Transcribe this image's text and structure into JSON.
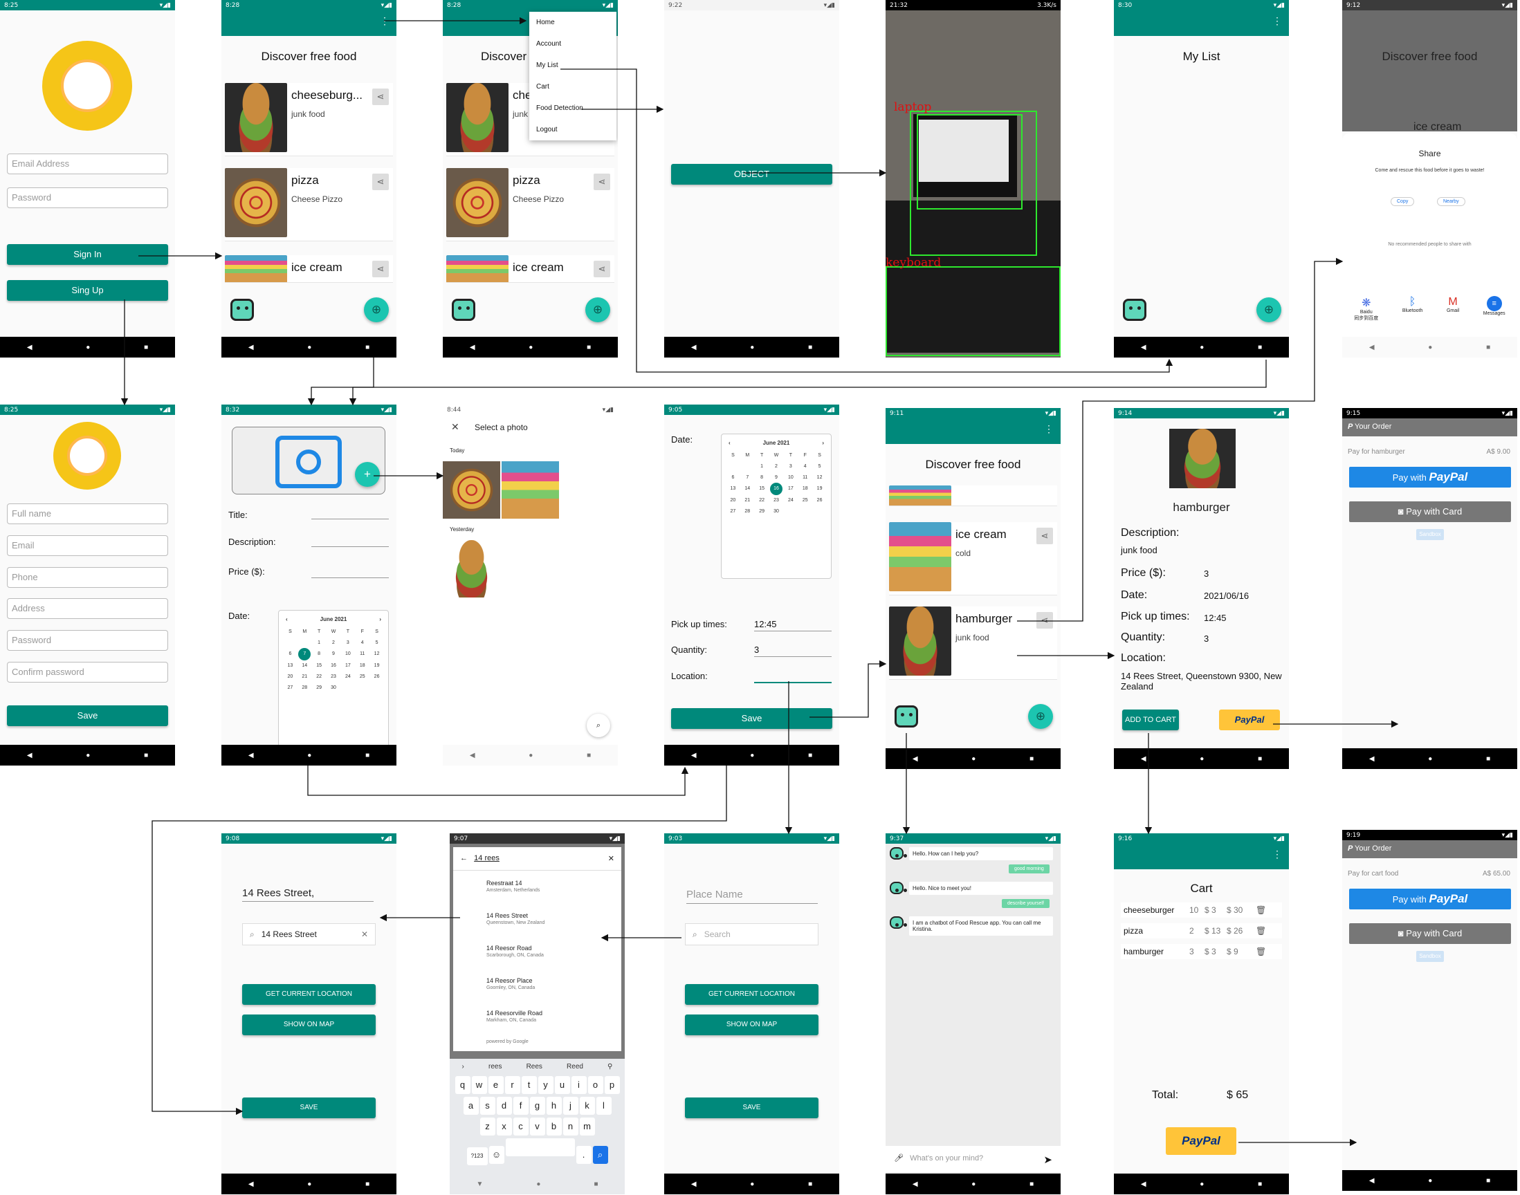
{
  "row1": {
    "login": {
      "time": "8:25",
      "email_placeholder": "Email Address",
      "password_placeholder": "Password",
      "signin": "Sign In",
      "signup": "Sing Up"
    },
    "discover": {
      "time": "8:28",
      "title": "Discover free food",
      "items": [
        {
          "name": "cheeseburg...",
          "desc": "junk food"
        },
        {
          "name": "pizza",
          "desc": "Cheese Pizzo"
        },
        {
          "name": "ice cream",
          "desc": ""
        }
      ]
    },
    "menu_screen": {
      "time": "8:28",
      "title": "Discover",
      "item1": "che",
      "item1_desc": "junk",
      "menu": [
        "Home",
        "Account",
        "My List",
        "Cart",
        "Food Detection",
        "Logout"
      ],
      "items": [
        {
          "name": "pizza",
          "desc": "Cheese Pizzo"
        },
        {
          "name": "ice cream"
        }
      ]
    },
    "object": {
      "time": "9:22",
      "button": "OBJECT"
    },
    "camera": {
      "time": "21:32",
      "speed": "3.3K/s",
      "labels": [
        "laptop",
        "keyboard"
      ]
    },
    "mylist": {
      "time": "8:30",
      "title": "My List"
    },
    "share": {
      "time": "9:12",
      "bg_title": "Discover free food",
      "bg_item": "ice cream",
      "title": "Share",
      "message": "Come and rescue this food before it goes to waste!",
      "copy": "Copy",
      "nearby": "Nearby",
      "no_rec": "No recommended people to share with",
      "apps": [
        {
          "name": "Baidu",
          "sub": "同步到百度"
        },
        {
          "name": "Bluetooth"
        },
        {
          "name": "Gmail"
        },
        {
          "name": "Messages"
        }
      ]
    }
  },
  "row2": {
    "register": {
      "time": "8:25",
      "fields": [
        "Full name",
        "Email",
        "Phone",
        "Address",
        "Password",
        "Confirm password"
      ],
      "save": "Save"
    },
    "addfood": {
      "time": "8:32",
      "title_lbl": "Title:",
      "desc_lbl": "Description:",
      "price_lbl": "Price ($):",
      "date_lbl": "Date:",
      "cal_month": "June 2021"
    },
    "photo": {
      "time": "8:44",
      "title": "Select a photo",
      "today": "Today",
      "yesterday": "Yesterday"
    },
    "datepick": {
      "time": "9:05",
      "date_lbl": "Date:",
      "cal_month": "June 2021",
      "pickup_lbl": "Pick up times:",
      "pickup": "12:45",
      "qty_lbl": "Quantity:",
      "qty": "3",
      "loc_lbl": "Location:",
      "save": "Save"
    },
    "discover2": {
      "time": "9:11",
      "title": "Discover free food",
      "items": [
        {
          "name": "ice cream",
          "desc": "cold"
        },
        {
          "name": "hamburger",
          "desc": "junk food"
        }
      ]
    },
    "detail": {
      "time": "9:14",
      "name": "hamburger",
      "desc_lbl": "Description:",
      "desc": "junk food",
      "price_lbl": "Price ($):",
      "price": "3",
      "date_lbl": "Date:",
      "date": "2021/06/16",
      "pickup_lbl": "Pick up times:",
      "pickup": "12:45",
      "qty_lbl": "Quantity:",
      "qty": "3",
      "loc_lbl": "Location:",
      "location": "14 Rees Street, Queenstown 9300, New Zealand",
      "add_cart": "ADD TO CART",
      "paypal": "PayPal"
    },
    "order1": {
      "time": "9:15",
      "header": "Your Order",
      "pay_for": "Pay for hamburger",
      "amount": "A$ 9.00",
      "pay_with": "Pay with",
      "paypal": "PayPal",
      "card": "Pay with Card",
      "sandbox": "Sandbox"
    }
  },
  "row3": {
    "address": {
      "time": "9:08",
      "street": "14 Rees Street,",
      "search": "14 Rees Street",
      "current": "GET CURRENT LOCATION",
      "show_map": "SHOW ON MAP",
      "save": "SAVE"
    },
    "autocomplete": {
      "time": "9:07",
      "query": "14 rees",
      "results": [
        {
          "name": "Reestraat 14",
          "addr": "Amsterdam, Netherlands"
        },
        {
          "name": "14 Rees Street",
          "addr": "Queenstown, New Zealand"
        },
        {
          "name": "14 Reesor Road",
          "addr": "Scarborough, ON, Canada"
        },
        {
          "name": "14 Reesor Place",
          "addr": "Goomley, ON, Canada"
        },
        {
          "name": "14 Reesorville Road",
          "addr": "Markham, ON, Canada"
        }
      ],
      "powered": "powered by Google",
      "suggest": [
        "rees",
        "Rees",
        "Reed"
      ],
      "row1": [
        "q",
        "w",
        "e",
        "r",
        "t",
        "y",
        "u",
        "i",
        "o",
        "p"
      ],
      "row2": [
        "a",
        "s",
        "d",
        "f",
        "g",
        "h",
        "j",
        "k",
        "l"
      ],
      "row3": [
        "z",
        "x",
        "c",
        "v",
        "b",
        "n",
        "m"
      ],
      "sym": "?123"
    },
    "place": {
      "time": "9:03",
      "place_ph": "Place Name",
      "search_ph": "Search",
      "current": "GET CURRENT LOCATION",
      "show_map": "SHOW ON MAP",
      "save": "SAVE"
    },
    "chatbot": {
      "time": "9:37",
      "msgs": [
        "Hello. How can I help you?",
        "Hello. Nice to meet you!",
        "I am a chatbot of Food Rescue app. You can call me Kristina."
      ],
      "chips": [
        "good morning",
        "describe yourself"
      ],
      "input_ph": "What's on your mind?"
    },
    "cart": {
      "time": "9:16",
      "title": "Cart",
      "rows": [
        {
          "name": "cheeseburger",
          "qty": "10",
          "price": "$ 3",
          "total": "$ 30"
        },
        {
          "name": "pizza",
          "qty": "2",
          "price": "$ 13",
          "total": "$ 26"
        },
        {
          "name": "hamburger",
          "qty": "3",
          "price": "$ 3",
          "total": "$ 9"
        }
      ],
      "total_lbl": "Total:",
      "total": "$ 65",
      "paypal": "PayPal"
    },
    "order2": {
      "time": "9:19",
      "header": "Your Order",
      "pay_for": "Pay for cart food",
      "amount": "A$ 65.00",
      "pay_with": "Pay with",
      "paypal": "PayPal",
      "card": "Pay with Card",
      "sandbox": "Sandbox"
    }
  }
}
